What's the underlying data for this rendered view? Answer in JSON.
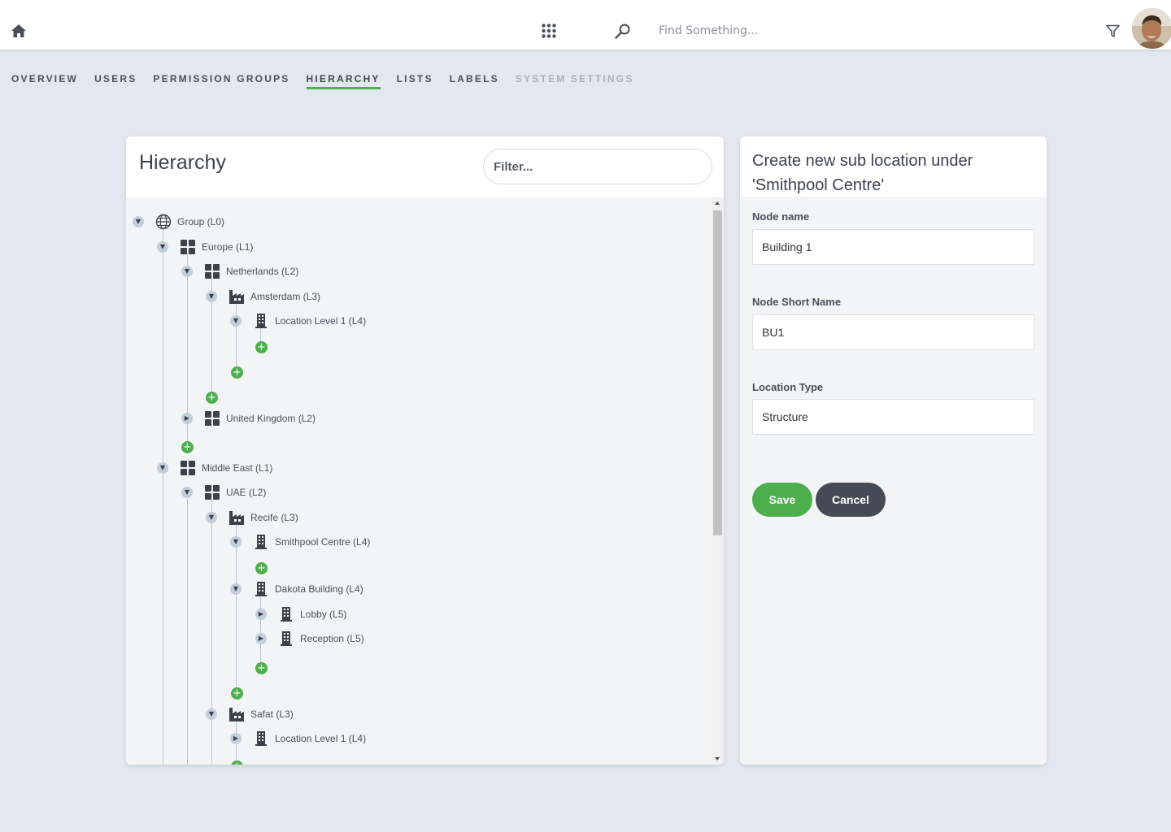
{
  "topbar": {
    "search_placeholder": "Find Something...",
    "icons": [
      "home-icon",
      "apps-grid-icon",
      "search-icon",
      "filter-icon",
      "avatar"
    ]
  },
  "nav": {
    "items": [
      {
        "label": "OVERVIEW",
        "state": "normal"
      },
      {
        "label": "USERS",
        "state": "normal"
      },
      {
        "label": "PERMISSION GROUPS",
        "state": "normal"
      },
      {
        "label": "HIERARCHY",
        "state": "active"
      },
      {
        "label": "LISTS",
        "state": "normal"
      },
      {
        "label": "LABELS",
        "state": "normal"
      },
      {
        "label": "SYSTEM SETTINGS",
        "state": "disabled"
      }
    ]
  },
  "hierarchy": {
    "title": "Hierarchy",
    "filter_placeholder": "Filter...",
    "nodes": [
      {
        "label": "Group (L0)",
        "icon": "globe-icon",
        "expanded": true
      },
      {
        "label": "Europe (L1)",
        "icon": "grid-icon",
        "expanded": true
      },
      {
        "label": "Netherlands (L2)",
        "icon": "grid-icon",
        "expanded": true
      },
      {
        "label": "Amsterdam (L3)",
        "icon": "factory-icon",
        "expanded": true
      },
      {
        "label": "Location Level 1 (L4)",
        "icon": "building-icon",
        "expanded": true
      },
      {
        "label": "United Kingdom (L2)",
        "icon": "grid-icon",
        "expanded": false
      },
      {
        "label": "Middle East (L1)",
        "icon": "grid-icon",
        "expanded": true
      },
      {
        "label": "UAE (L2)",
        "icon": "grid-icon",
        "expanded": true
      },
      {
        "label": "Recife (L3)",
        "icon": "factory-icon",
        "expanded": true
      },
      {
        "label": "Smithpool Centre (L4)",
        "icon": "building-icon",
        "expanded": true
      },
      {
        "label": "Dakota Building (L4)",
        "icon": "building-icon",
        "expanded": true
      },
      {
        "label": "Lobby (L5)",
        "icon": "building-icon",
        "expanded": false
      },
      {
        "label": "Reception (L5)",
        "icon": "building-icon",
        "expanded": false
      },
      {
        "label": "Safat (L3)",
        "icon": "factory-icon",
        "expanded": true
      },
      {
        "label": "Location Level 1 (L4)",
        "icon": "building-icon",
        "expanded": false
      }
    ]
  },
  "form": {
    "title": "Create new sub location under 'Smithpool Centre'",
    "node_name_label": "Node name",
    "node_name_value": "Building 1",
    "short_name_label": "Node Short Name",
    "short_name_value": "BU1",
    "location_type_label": "Location Type",
    "location_type_value": "Structure",
    "save_label": "Save",
    "cancel_label": "Cancel"
  },
  "colors": {
    "accent": "#4cae4c",
    "background": "#e3e8f0",
    "dark_button": "#454b55"
  }
}
